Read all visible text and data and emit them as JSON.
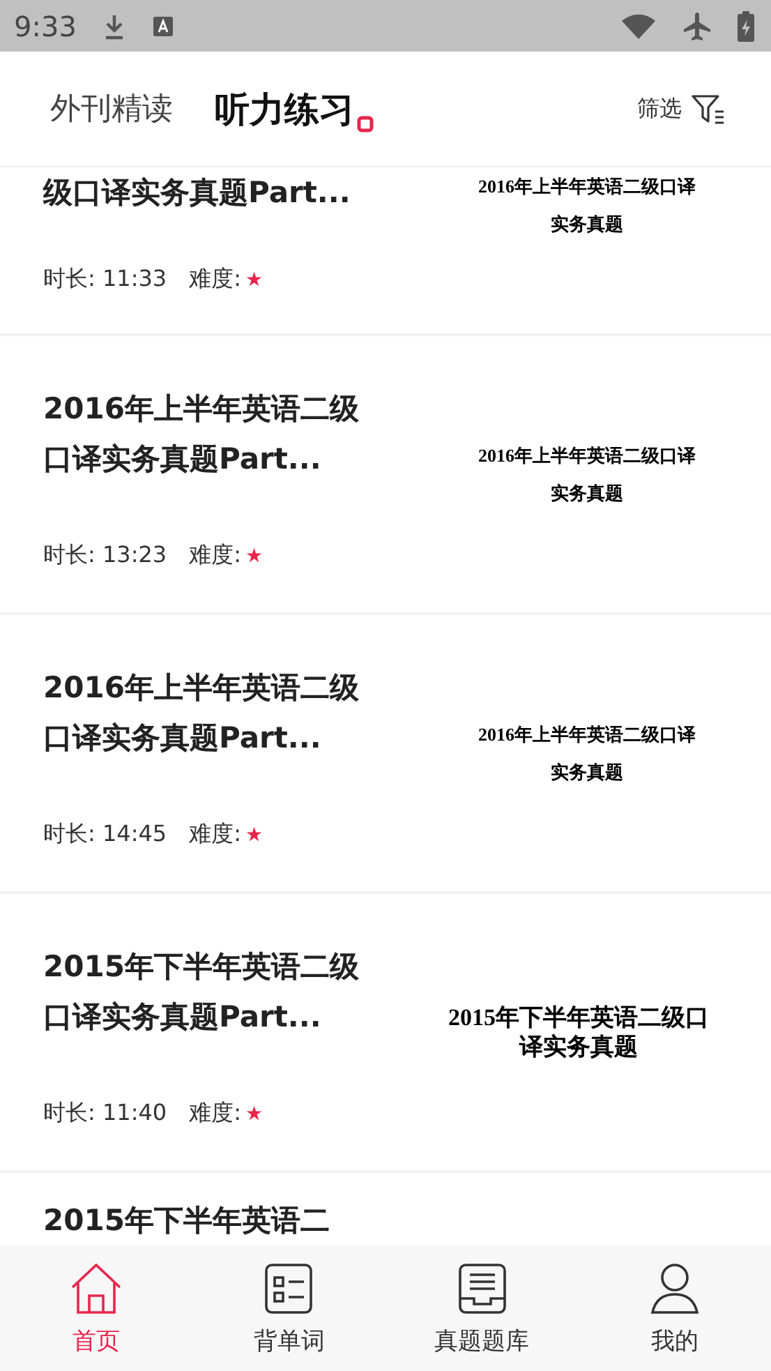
{
  "status_bar": {
    "time": "9:33"
  },
  "tabs": [
    {
      "label": "外刊精读",
      "selected": false
    },
    {
      "label": "听力练习",
      "selected": true
    }
  ],
  "filter": {
    "label": "筛选"
  },
  "items": [
    {
      "title": "级口译实务真题Part...",
      "duration_label": "时长:",
      "duration": "11:33",
      "difficulty_label": "难度:",
      "difficulty": "★",
      "cover_text": "2016年上半年英语二级口译实务真题"
    },
    {
      "title": "2016年上半年英语二级口译实务真题Part...",
      "duration_label": "时长:",
      "duration": "13:23",
      "difficulty_label": "难度:",
      "difficulty": "★",
      "cover_text": "2016年上半年英语二级口译实务真题"
    },
    {
      "title": "2016年上半年英语二级口译实务真题Part...",
      "duration_label": "时长:",
      "duration": "14:45",
      "difficulty_label": "难度:",
      "difficulty": "★",
      "cover_text": "2016年上半年英语二级口译实务真题"
    },
    {
      "title": "2015年下半年英语二级口译实务真题Part...",
      "duration_label": "时长:",
      "duration": "11:40",
      "difficulty_label": "难度:",
      "difficulty": "★",
      "cover_text": "2015年下半年英语二级口译实务真题"
    },
    {
      "title": "2015年下半年英语二"
    }
  ],
  "bottom_nav": [
    {
      "label": "首页",
      "kind": "home",
      "selected": true
    },
    {
      "label": "背单词",
      "kind": "list",
      "selected": false
    },
    {
      "label": "真题题库",
      "kind": "tray",
      "selected": false
    },
    {
      "label": "我的",
      "kind": "person",
      "selected": false
    }
  ]
}
